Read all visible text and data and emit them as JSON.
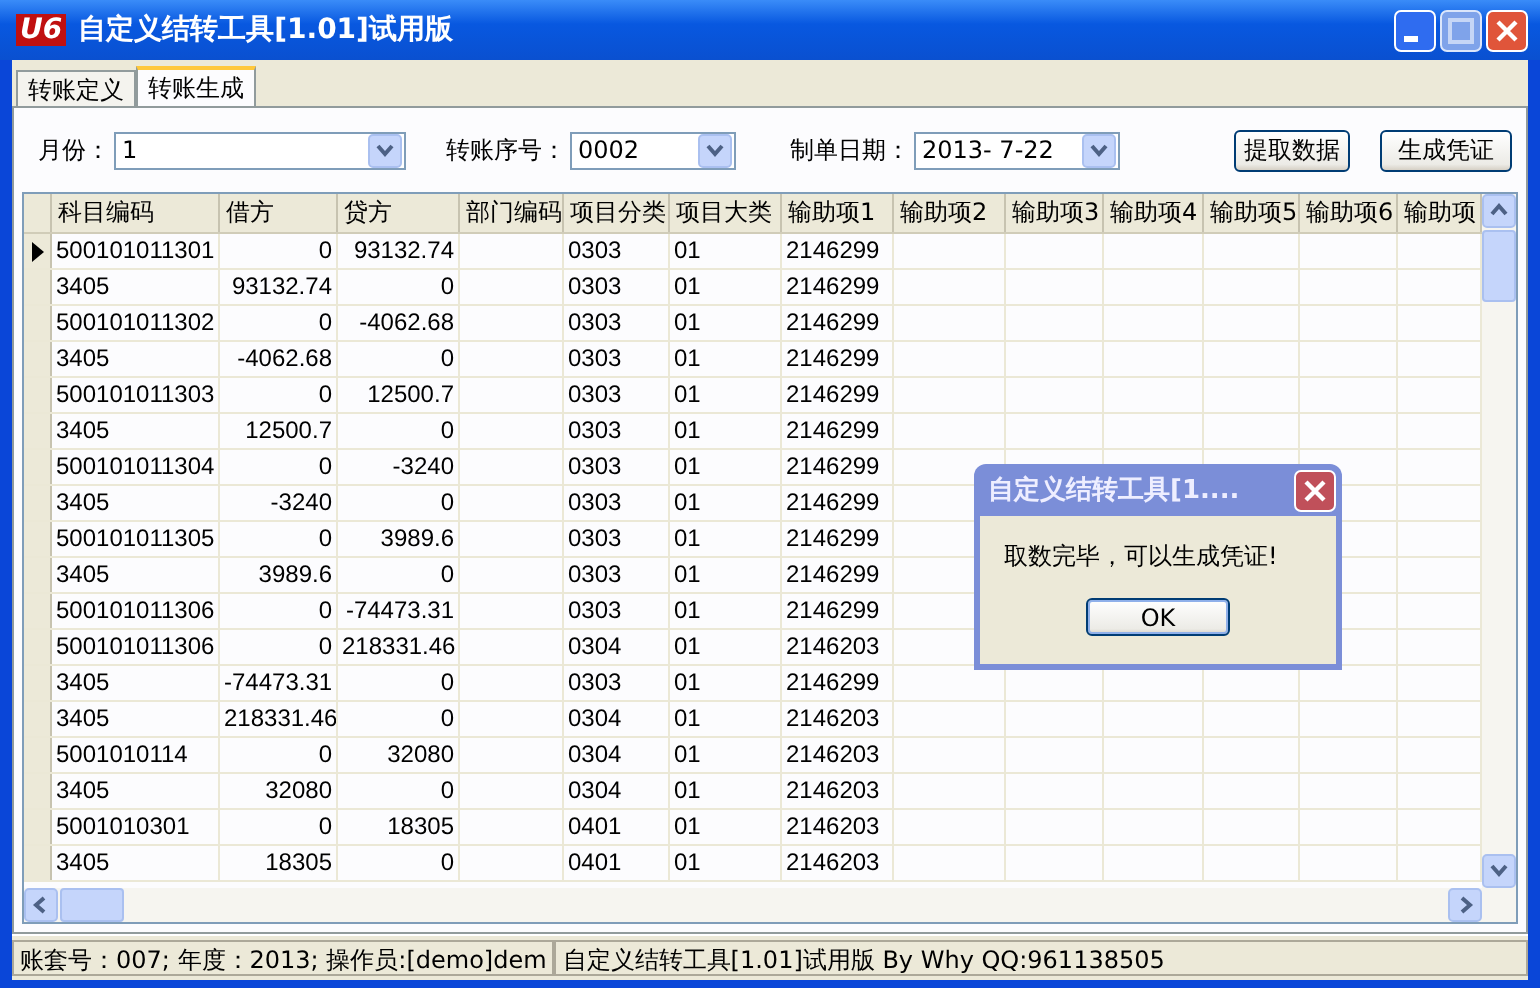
{
  "window": {
    "logo": "U6",
    "title": "自定义结转工具[1.01]试用版"
  },
  "tabs": [
    {
      "label": "转账定义",
      "selected": false
    },
    {
      "label": "转账生成",
      "selected": true
    }
  ],
  "filters": [
    {
      "label": "月份：",
      "value": "1"
    },
    {
      "label": "转账序号：",
      "value": "0002"
    },
    {
      "label": "制单日期：",
      "value": "2013- 7-22"
    }
  ],
  "buttons": [
    "提取数据",
    "生成凭证"
  ],
  "table": {
    "columns": [
      "科目编码",
      "借方",
      "贷方",
      "部门编码",
      "项目分类",
      "项目大类",
      "输助项1",
      "输助项2",
      "输助项3",
      "输助项4",
      "输助项5",
      "输助项6",
      "输助项"
    ],
    "rows": [
      {
        "selected": true,
        "cells": [
          "500101011301",
          "0",
          "93132.74",
          "",
          "0303",
          "01",
          "2146299"
        ]
      },
      {
        "selected": false,
        "cells": [
          "3405",
          "93132.74",
          "0",
          "",
          "0303",
          "01",
          "2146299"
        ]
      },
      {
        "selected": false,
        "cells": [
          "500101011302",
          "0",
          "-4062.68",
          "",
          "0303",
          "01",
          "2146299"
        ]
      },
      {
        "selected": false,
        "cells": [
          "3405",
          "-4062.68",
          "0",
          "",
          "0303",
          "01",
          "2146299"
        ]
      },
      {
        "selected": false,
        "cells": [
          "500101011303",
          "0",
          "12500.7",
          "",
          "0303",
          "01",
          "2146299"
        ]
      },
      {
        "selected": false,
        "cells": [
          "3405",
          "12500.7",
          "0",
          "",
          "0303",
          "01",
          "2146299"
        ]
      },
      {
        "selected": false,
        "cells": [
          "500101011304",
          "0",
          "-3240",
          "",
          "0303",
          "01",
          "2146299"
        ]
      },
      {
        "selected": false,
        "cells": [
          "3405",
          "-3240",
          "0",
          "",
          "0303",
          "01",
          "2146299"
        ]
      },
      {
        "selected": false,
        "cells": [
          "500101011305",
          "0",
          "3989.6",
          "",
          "0303",
          "01",
          "2146299"
        ]
      },
      {
        "selected": false,
        "cells": [
          "3405",
          "3989.6",
          "0",
          "",
          "0303",
          "01",
          "2146299"
        ]
      },
      {
        "selected": false,
        "cells": [
          "500101011306",
          "0",
          "-74473.31",
          "",
          "0303",
          "01",
          "2146299"
        ]
      },
      {
        "selected": false,
        "cells": [
          "500101011306",
          "0",
          "218331.46",
          "",
          "0304",
          "01",
          "2146203"
        ]
      },
      {
        "selected": false,
        "cells": [
          "3405",
          "-74473.31",
          "0",
          "",
          "0303",
          "01",
          "2146299"
        ]
      },
      {
        "selected": false,
        "cells": [
          "3405",
          "218331.46",
          "0",
          "",
          "0304",
          "01",
          "2146203"
        ]
      },
      {
        "selected": false,
        "cells": [
          "5001010114",
          "0",
          "32080",
          "",
          "0304",
          "01",
          "2146203"
        ]
      },
      {
        "selected": false,
        "cells": [
          "3405",
          "32080",
          "0",
          "",
          "0304",
          "01",
          "2146203"
        ]
      },
      {
        "selected": false,
        "cells": [
          "5001010301",
          "0",
          "18305",
          "",
          "0401",
          "01",
          "2146203"
        ]
      },
      {
        "selected": false,
        "cells": [
          "3405",
          "18305",
          "0",
          "",
          "0401",
          "01",
          "2146203"
        ]
      }
    ]
  },
  "dialog": {
    "title": "自定义结转工具[1....",
    "message": "取数完毕，可以生成凭证!",
    "button": "OK"
  },
  "status_bar": [
    "账套号：007; 年度：2013; 操作员:[demo]dem",
    "自定义结转工具[1.01]试用版 By Why QQ:961138505"
  ]
}
